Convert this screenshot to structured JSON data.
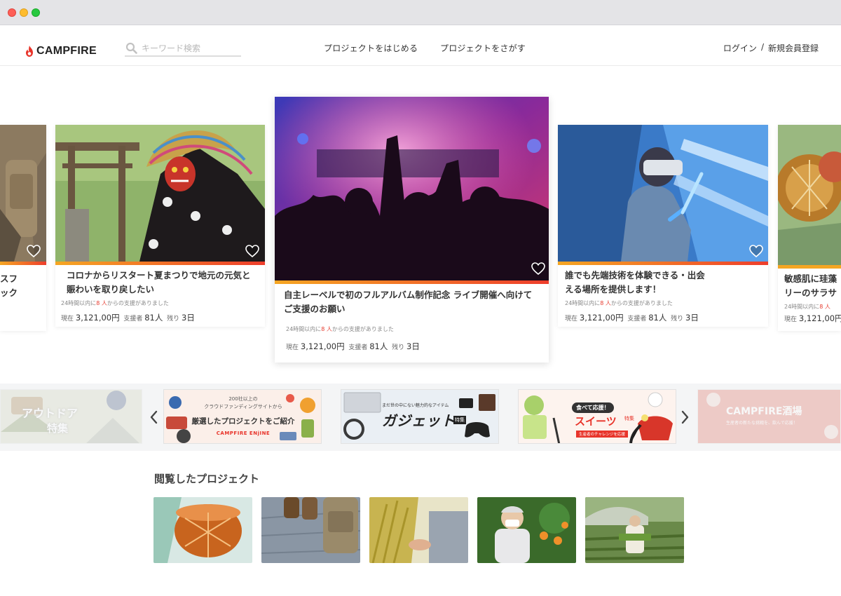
{
  "brand": {
    "name": "CAMPFIRE",
    "accent": "#e8342a"
  },
  "search": {
    "placeholder": "キーワード検索"
  },
  "nav": {
    "start": "プロジェクトをはじめる",
    "find": "プロジェクトをさがす"
  },
  "auth": {
    "login": "ログイン",
    "divider": "/",
    "register": "新規会員登録"
  },
  "projects": [
    {
      "title_line1": "スフ",
      "title_line2": "ック"
    },
    {
      "title_line1": "コロナからリスタート夏まつりで地元の元気と",
      "title_line2": "賑わいを取り戻したい",
      "note_prefix": "24時間以内に",
      "note_count": "8 人",
      "note_suffix": "からの支援がありました",
      "current_label": "現在",
      "current_value": "3,121,00円",
      "backers_label": "支援者",
      "backers_value": "81人",
      "remaining_label": "残り",
      "remaining_value": "3日"
    },
    {
      "title_line1": "自主レーベルで初のフルアルバム制作記念 ライブ開催へ向けて",
      "title_line2": "ご支援のお願い",
      "note_prefix": "24時間以内に",
      "note_count": "8 人",
      "note_suffix": "からの支援がありました",
      "current_label": "現在",
      "current_value": "3,121,00円",
      "backers_label": "支援者",
      "backers_value": "81人",
      "remaining_label": "残り",
      "remaining_value": "3日"
    },
    {
      "title_line1": "誰でも先端技術を体験できる・出会",
      "title_line2": "える場所を提供します！",
      "note_prefix": "24時間以内に",
      "note_count": "8 人",
      "note_suffix": "からの支援がありました",
      "current_label": "現在",
      "current_value": "3,121,00円",
      "backers_label": "支援者",
      "backers_value": "81人",
      "remaining_label": "残り",
      "remaining_value": "3日"
    },
    {
      "title_line1": "敏感肌に珪藻",
      "title_line2": "リーのサラサ",
      "note_prefix": "24時間以内に",
      "note_count": "8 人",
      "current_label": "現在",
      "current_value": "3,121,00円"
    }
  ],
  "banners": [
    {
      "title": "アウトドア",
      "sub": "特集"
    },
    {
      "top_line1": "200社以上の",
      "top_line2": "クラウドファンディングサイトから",
      "title": "厳選したプロジェクトをご紹介",
      "brand": "CAMPFIRE ENjINE"
    },
    {
      "top": "まだ世の中にない魅力的なアイテム",
      "title": "ガジェット",
      "tag": "特集"
    },
    {
      "top": "食べて応援！",
      "title": "スイーツ",
      "tag": "特集",
      "sub": "生産者のチャレンジを応援"
    },
    {
      "title": "CAMPFIRE酒場",
      "sub": "生産者の新たな挑戦を、飲んで応援！"
    }
  ],
  "viewed": {
    "title": "閲覧したプロジェクト"
  }
}
